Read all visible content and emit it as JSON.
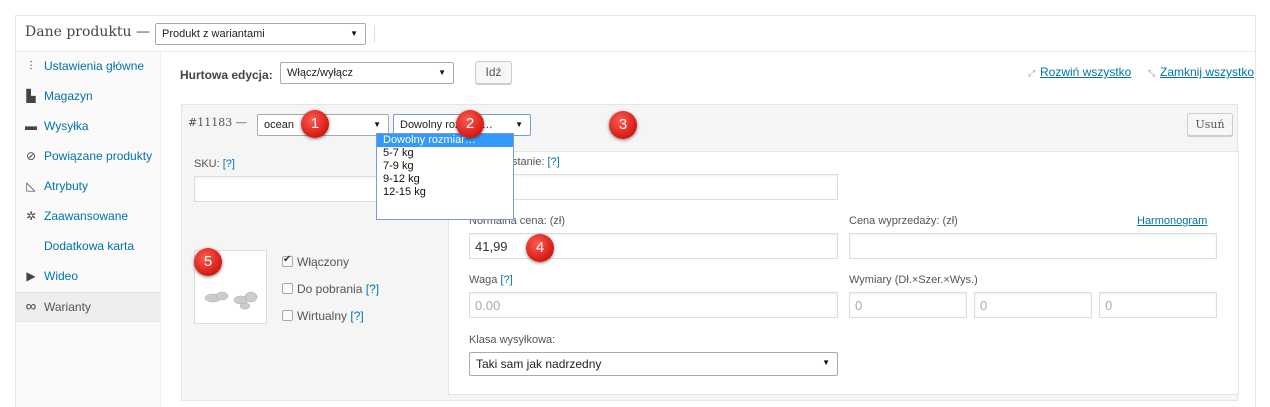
{
  "panel": {
    "title": "Dane produktu —",
    "product_type": "Produkt z wariantami"
  },
  "sidebar": {
    "items": [
      {
        "label": "Ustawienia główne",
        "icon": "sliders-icon"
      },
      {
        "label": "Magazyn",
        "icon": "boxes-icon"
      },
      {
        "label": "Wysyłka",
        "icon": "truck-icon"
      },
      {
        "label": "Powiązane produkty",
        "icon": "link-icon"
      },
      {
        "label": "Atrybuty",
        "icon": "triangle-ruler-icon"
      },
      {
        "label": "Zaawansowane",
        "icon": "gear-icon"
      },
      {
        "label": "Dodatkowa karta",
        "icon": ""
      },
      {
        "label": "Wideo",
        "icon": "play-icon"
      },
      {
        "label": "Warianty",
        "icon": "infinity-icon"
      }
    ]
  },
  "bulk": {
    "label": "Hurtowa edycja:",
    "selected": "Włącz/wyłącz",
    "go_label": "Idź",
    "expand_label": "Rozwiń wszystko",
    "collapse_label": "Zamknij wszystko"
  },
  "variation": {
    "id": "#11183 —",
    "color": "ocean",
    "size": "Dowolny rozmiar…",
    "remove_label": "Usuń",
    "size_options": [
      "Dowolny rozmiar…",
      "5-7 kg",
      "7-9 kg",
      "9-12 kg",
      "12-15 kg"
    ],
    "sku_label": "SKU:",
    "help": "[?]",
    "stock_label_visible": "stanie:",
    "regular_price_label": "Normalna cena: (zł)",
    "regular_price": "41,99",
    "sale_price_label": "Cena wyprzedaży: (zł)",
    "schedule_label": "Harmonogram",
    "weight_label": "Waga",
    "weight_placeholder": "0.00",
    "dims_label": "Wymiary (Dł.×Szer.×Wys.)",
    "dims_placeholder": "0",
    "shipping_class_label": "Klasa wysyłkowa:",
    "shipping_class": "Taki sam jak nadrzedny",
    "enabled_label": "Włączony",
    "downloadable_label": "Do pobrania",
    "virtual_label": "Wirtualny",
    "enabled": true,
    "downloadable": false,
    "virtual": false
  },
  "markers": [
    "1",
    "2",
    "3",
    "4",
    "5"
  ],
  "colors": {
    "link": "#0073aa",
    "marker": "#d41a12",
    "dropdown_highlight": "#3399ff"
  }
}
